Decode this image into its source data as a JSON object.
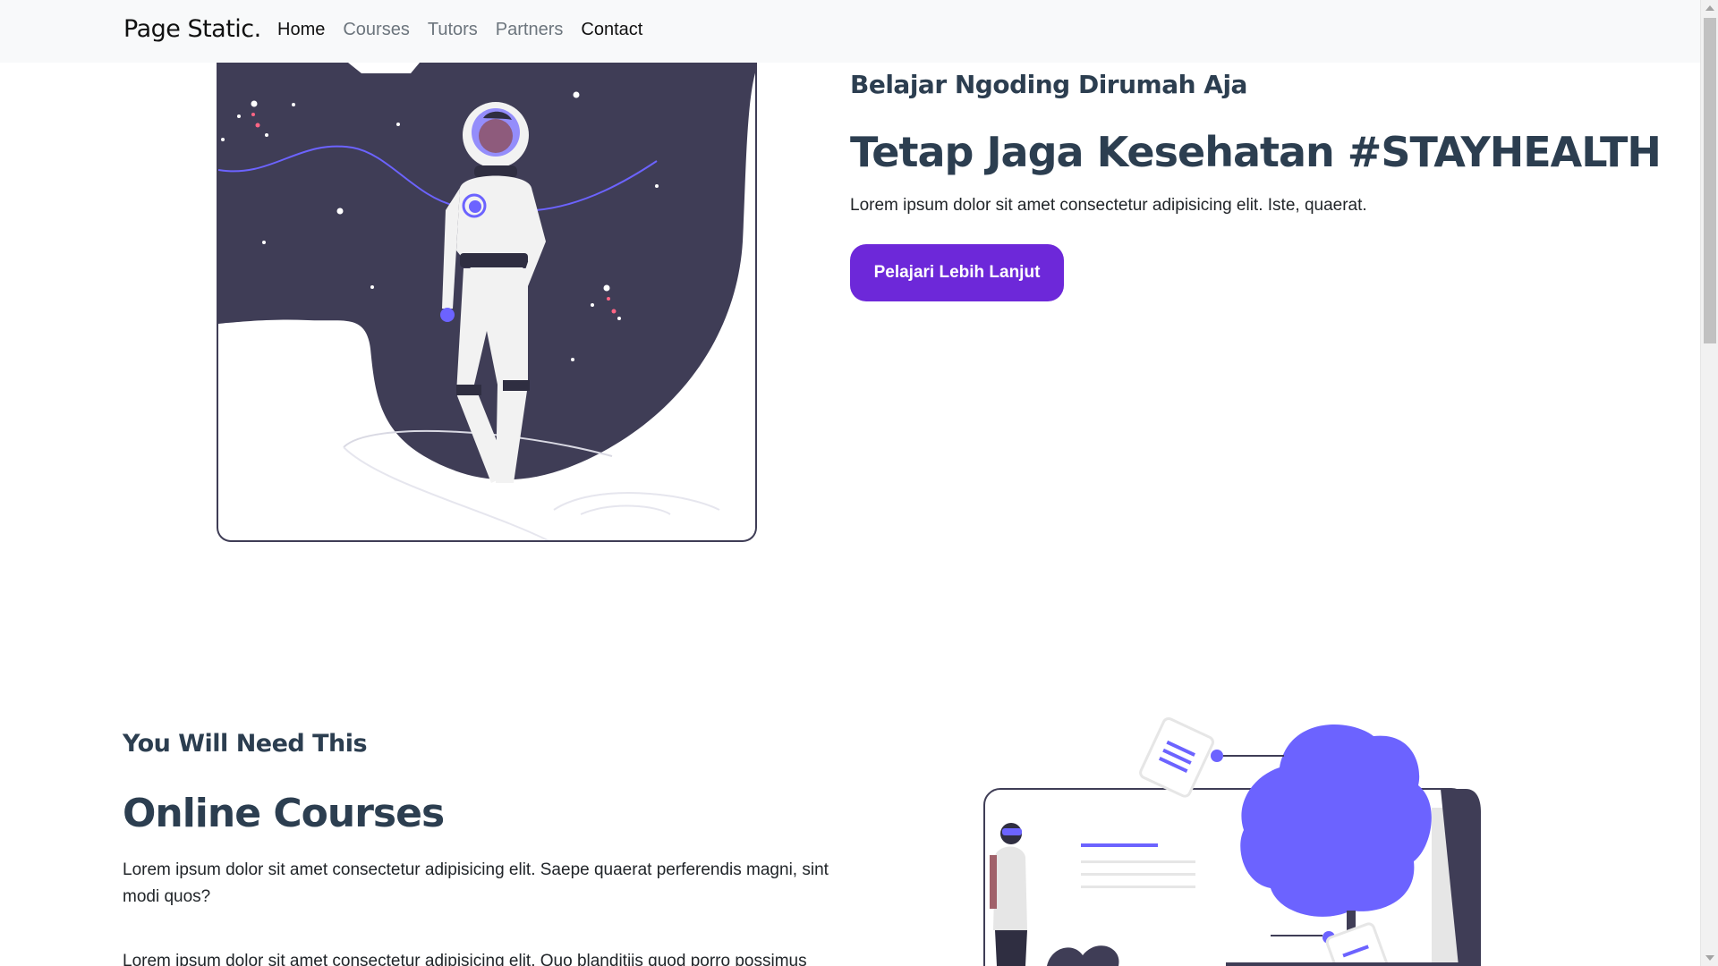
{
  "navbar": {
    "brand": "Page Static.",
    "links": [
      {
        "label": "Home",
        "active": true
      },
      {
        "label": "Courses",
        "active": false
      },
      {
        "label": "Tutors",
        "active": false
      },
      {
        "label": "Partners",
        "active": false
      },
      {
        "label": "Contact",
        "active": true
      }
    ]
  },
  "hero": {
    "kicker": "Belajar Ngoding Dirumah Aja",
    "title": "Tetap Jaga Kesehatan #STAYHEALTH",
    "text": "Lorem ipsum dolor sit amet consectetur adipisicing elit. Iste, quaerat.",
    "button_label": "Pelajari Lebih Lanjut",
    "illustration": "astronaut-illustration"
  },
  "section2": {
    "kicker": "You Will Need This",
    "title": "Online Courses",
    "para1": "Lorem ipsum dolor sit amet consectetur adipisicing elit. Saepe quaerat perferendis magni, sint modi quos?",
    "para2": "Lorem ipsum dolor sit amet consectetur adipisicing elit. Quo blanditiis quod porro possimus",
    "illustration": "online-learning-illustration"
  },
  "colors": {
    "accent": "#6d28d9",
    "navy": "#3f3d56",
    "purple": "#6c63ff",
    "heading": "#2c3e50"
  }
}
